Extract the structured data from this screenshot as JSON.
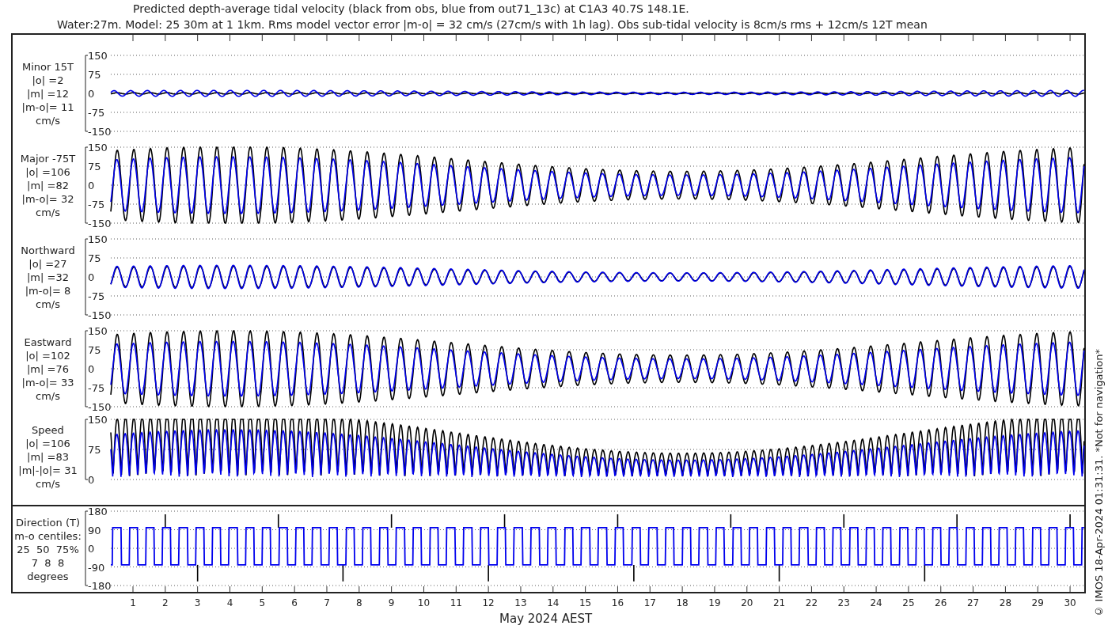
{
  "title": [
    "Predicted depth-average tidal velocity (black from obs, blue from out71_13c) at C1A3 40.7S 148.1E.",
    "Water:27m. Model: 25 30m at 1 1km. Rms model vector error |m-o| = 32 cm/s (27cm/s with 1h lag). Obs sub-tidal velocity is 8cm/s rms + 12cm/s 12T mean"
  ],
  "panels": [
    {
      "kind": "signed",
      "label_lines": [
        "Minor 15T",
        "|o| =2",
        "|m| =12",
        "|m-o|= 11",
        "cm/s"
      ],
      "yticks": [
        "150",
        "75",
        "0",
        "-75",
        "-150"
      ]
    },
    {
      "kind": "signed",
      "label_lines": [
        "Major -75T",
        "|o| =106",
        "|m| =82",
        "|m-o|= 32",
        "cm/s"
      ],
      "yticks": [
        "150",
        "75",
        "0",
        "-75",
        "-150"
      ]
    },
    {
      "kind": "signed",
      "label_lines": [
        "Northward",
        "|o| =27",
        "|m| =32",
        "|m-o|= 8",
        "cm/s"
      ],
      "yticks": [
        "150",
        "75",
        "0",
        "-75",
        "-150"
      ]
    },
    {
      "kind": "signed",
      "label_lines": [
        "Eastward",
        "|o| =102",
        "|m| =76",
        "|m-o|= 33",
        "cm/s"
      ],
      "yticks": [
        "150",
        "75",
        "0",
        "-75",
        "-150"
      ]
    },
    {
      "kind": "speed",
      "label_lines": [
        "Speed",
        "|o| =106",
        "|m| =83",
        "|m|-|o|= 31",
        "cm/s"
      ],
      "yticks": [
        "150",
        "75",
        "0"
      ]
    }
  ],
  "direction_panel": {
    "kind": "direction",
    "label_lines": [
      "Direction (T)",
      "m-o centiles:",
      "25  50  75%",
      "7  8  8",
      "degrees"
    ],
    "yticks": [
      "180",
      "90",
      "0",
      "-90",
      "-180"
    ]
  },
  "x_ticks": [
    "1",
    "2",
    "3",
    "4",
    "5",
    "6",
    "7",
    "8",
    "9",
    "10",
    "11",
    "12",
    "13",
    "14",
    "15",
    "16",
    "17",
    "18",
    "19",
    "20",
    "21",
    "22",
    "23",
    "24",
    "25",
    "26",
    "27",
    "28",
    "29",
    "30"
  ],
  "xlabel": "May 2024 AEST",
  "footer": "© IMOS 18-Apr-2024 01:31:31. *Not for navigation*"
}
